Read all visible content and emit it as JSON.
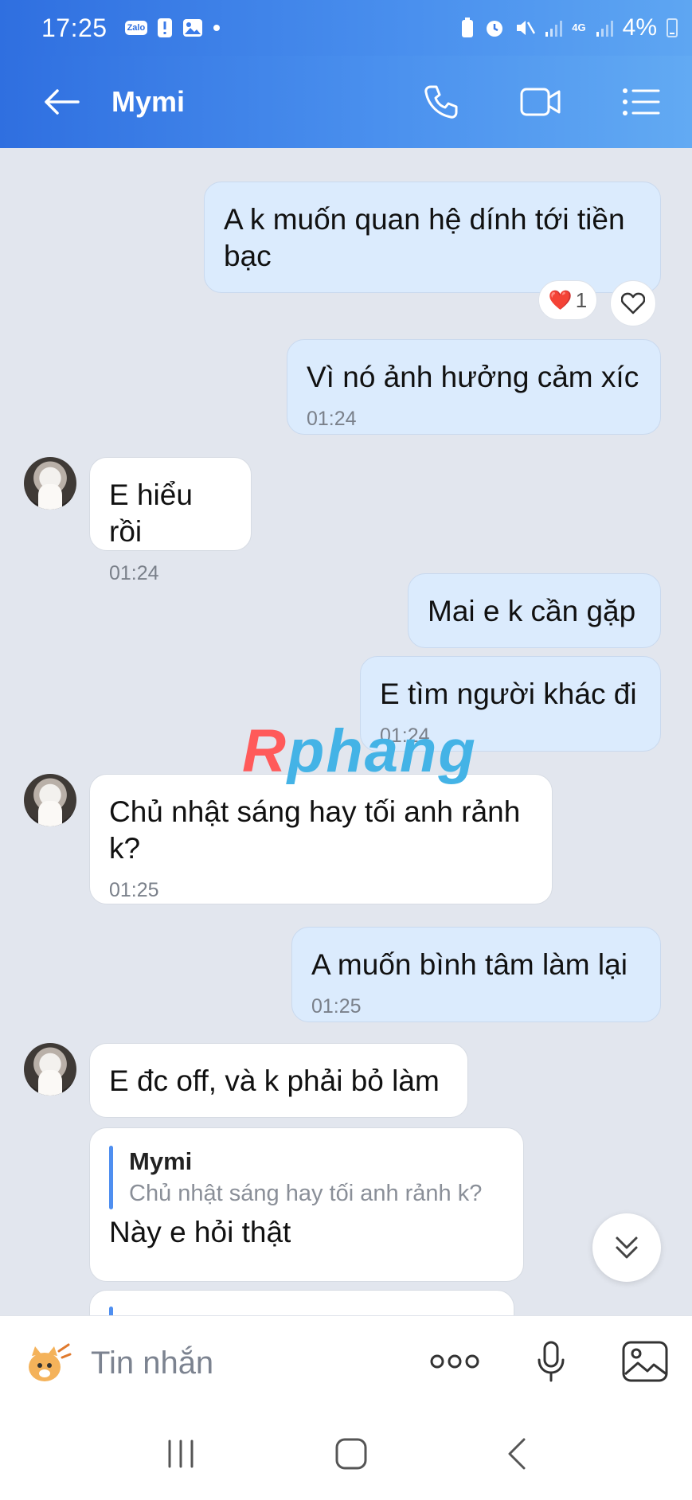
{
  "status_bar": {
    "time": "17:25",
    "zalo_badge": "Zalo",
    "battery": "4%",
    "network": "4G"
  },
  "header": {
    "contact_name": "Mymi"
  },
  "messages": [
    {
      "dir": "out",
      "text": "A k muốn quan hệ dính tới tiền bạc"
    },
    {
      "dir": "out",
      "text": "Vì nó ảnh hưởng cảm xíc",
      "time": "01:24"
    },
    {
      "dir": "in",
      "text": "E hiểu rồi",
      "time": "01:24"
    },
    {
      "dir": "out",
      "text": "Mai e k cần gặp"
    },
    {
      "dir": "out",
      "text": "E tìm người khác đi",
      "time": "01:24"
    },
    {
      "dir": "in",
      "text": "Chủ nhật sáng hay tối anh rảnh k?",
      "time": "01:25"
    },
    {
      "dir": "out",
      "text": "A muốn bình tâm làm lại",
      "time": "01:25"
    },
    {
      "dir": "in",
      "text": "E đc off, và k phải bỏ làm"
    },
    {
      "dir": "in",
      "quote_name": "Mymi",
      "quote_text": "Chủ nhật sáng hay tối anh rảnh k?",
      "text": "Này e hỏi thật"
    }
  ],
  "reaction": {
    "emoji": "❤️",
    "count": "1"
  },
  "watermark": {
    "first": "R",
    "rest": "phang"
  },
  "composer": {
    "placeholder": "Tin nhắn"
  },
  "colors": {
    "accent": "#2f6fe0",
    "out_bubble": "#dbebfd",
    "in_bubble": "#ffffff",
    "background": "#e2e6ee"
  }
}
